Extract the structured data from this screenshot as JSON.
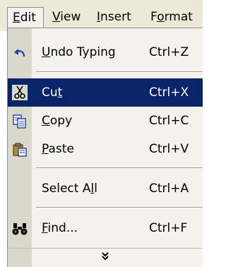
{
  "menubar": {
    "edit": {
      "label": "Edit",
      "mnemonic": "E",
      "rest": "dit"
    },
    "view": {
      "label": "View",
      "mnemonic": "V",
      "rest": "iew"
    },
    "insert": {
      "label": "Insert",
      "mnemonic": "I",
      "rest": "nsert"
    },
    "format": {
      "label": "Format",
      "pre": "F",
      "mnemonic": "o",
      "rest": "rmat"
    }
  },
  "menu": {
    "items": [
      {
        "label": "Undo Typing",
        "pre": "",
        "mnemonic": "U",
        "rest": "ndo Typing",
        "shortcut": "Ctrl+Z",
        "icon": "undo-icon"
      },
      {
        "label": "Cut",
        "pre": "Cu",
        "mnemonic": "t",
        "rest": "",
        "shortcut": "Ctrl+X",
        "icon": "scissors-icon",
        "highlighted": true
      },
      {
        "label": "Copy",
        "pre": "",
        "mnemonic": "C",
        "rest": "opy",
        "shortcut": "Ctrl+C",
        "icon": "copy-icon"
      },
      {
        "label": "Paste",
        "pre": "",
        "mnemonic": "P",
        "rest": "aste",
        "shortcut": "Ctrl+V",
        "icon": "clipboard-icon"
      },
      {
        "label": "Select All",
        "pre": "Select A",
        "mnemonic": "l",
        "rest": "l",
        "shortcut": "Ctrl+A",
        "icon": ""
      },
      {
        "label": "Find...",
        "pre": "",
        "mnemonic": "F",
        "rest": "ind...",
        "shortcut": "Ctrl+F",
        "icon": "binoculars-icon"
      }
    ],
    "more_icon": "double-chevron-down-icon"
  },
  "colors": {
    "menubar_bg": "#ece9d8",
    "menu_bg": "#f3f2ec",
    "gutter_bg": "#dad7cb",
    "highlight_bg": "#0a246a",
    "highlight_text": "#ffffff"
  }
}
